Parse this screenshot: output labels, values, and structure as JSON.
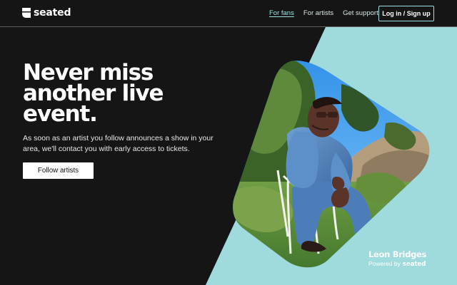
{
  "brand": {
    "name": "seated",
    "logo_icon": "seated-logo-icon"
  },
  "nav": {
    "for_fans": "For fans",
    "for_artists": "For artists",
    "get_support": "Get support",
    "login": "Log in / Sign up"
  },
  "hero": {
    "headline": "Never miss another live event.",
    "subtext": "As soon as an artist you follow announces a show in your area, we'll contact you with early access to tickets.",
    "cta": "Follow artists"
  },
  "feature": {
    "artist_name": "Leon Bridges",
    "powered_by": "Powered by",
    "powered_brand": "seated",
    "image_subject": "artist-photo"
  },
  "colors": {
    "background": "#151515",
    "accent": "#9fe0e4",
    "text": "#ffffff"
  }
}
